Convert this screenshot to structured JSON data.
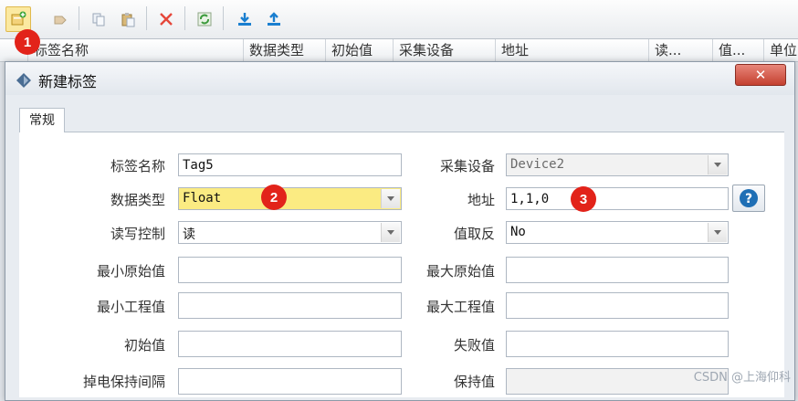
{
  "grid_columns": [
    "标签名称",
    "数据类型",
    "初始值",
    "采集设备",
    "地址",
    "读...",
    "值...",
    "单位"
  ],
  "dialog": {
    "title": "新建标签",
    "close_symbol": "✕",
    "tab": "常规"
  },
  "fields": {
    "tag_name": {
      "label": "标签名称",
      "value": "Tag5"
    },
    "device": {
      "label": "采集设备",
      "value": "Device2"
    },
    "data_type": {
      "label": "数据类型",
      "value": "Float"
    },
    "address": {
      "label": "地址",
      "value": "1,1,0"
    },
    "rw_control": {
      "label": "读写控制",
      "value": "读"
    },
    "invert": {
      "label": "值取反",
      "value": "No"
    },
    "min_raw": {
      "label": "最小原始值",
      "value": ""
    },
    "max_raw": {
      "label": "最大原始值",
      "value": ""
    },
    "min_eng": {
      "label": "最小工程值",
      "value": ""
    },
    "max_eng": {
      "label": "最大工程值",
      "value": ""
    },
    "initial": {
      "label": "初始值",
      "value": ""
    },
    "fail": {
      "label": "失败值",
      "value": ""
    },
    "retain_interval": {
      "label": "掉电保持间隔",
      "value": ""
    },
    "retain_value": {
      "label": "保持值",
      "value": ""
    }
  },
  "badges": [
    "1",
    "2",
    "3"
  ],
  "help_symbol": "?",
  "watermark": "CSDN @上海仰科",
  "colors": {
    "badge": "#e2231a",
    "highlight": "#fbeb82",
    "help_icon": "#1f6fb5",
    "download_icon": "#1a7fd0"
  }
}
